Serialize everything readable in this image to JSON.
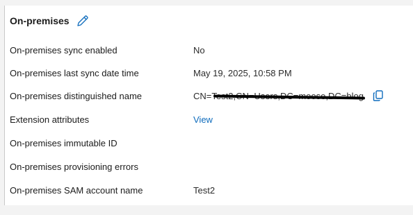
{
  "section": {
    "title": "On-premises",
    "edit_icon": "pencil-icon"
  },
  "rows": [
    {
      "label": "On-premises sync enabled",
      "value": "No"
    },
    {
      "label": "On-premises last sync date time",
      "value": "May 19, 2025, 10:58 PM"
    },
    {
      "label": "On-premises distinguished name",
      "value": "CN=Test2,CN=Users,DC=moose,DC=blog",
      "copy_icon": "copy-icon"
    },
    {
      "label": "Extension attributes",
      "value": "View"
    },
    {
      "label": "On-premises immutable ID",
      "value": ""
    },
    {
      "label": "On-premises provisioning errors",
      "value": ""
    },
    {
      "label": "On-premises SAM account name",
      "value": "Test2"
    }
  ],
  "colors": {
    "accent": "#0f6cbd",
    "text": "#1b1b1b",
    "background": "#ffffff"
  }
}
